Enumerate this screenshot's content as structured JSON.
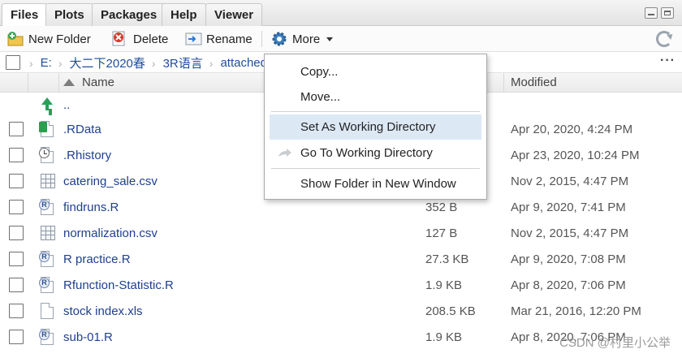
{
  "tabs": [
    {
      "label": "Files",
      "active": true
    },
    {
      "label": "Plots",
      "active": false
    },
    {
      "label": "Packages",
      "active": false
    },
    {
      "label": "Help",
      "active": false
    },
    {
      "label": "Viewer",
      "active": false
    }
  ],
  "toolbar": {
    "new_folder": "New Folder",
    "delete": "Delete",
    "rename": "Rename",
    "more": "More"
  },
  "breadcrumb": [
    "E:",
    "大二下2020春",
    "3R语言",
    "attached"
  ],
  "columns": {
    "name": "Name",
    "size": "",
    "modified": "Modified"
  },
  "parent_dir": "..",
  "files": [
    {
      "name": ".RData",
      "size": "",
      "modified": "Apr 20, 2020, 4:24 PM",
      "icon": "rdata-icon"
    },
    {
      "name": ".Rhistory",
      "size": "",
      "modified": "Apr 23, 2020, 10:24 PM",
      "icon": "history-icon"
    },
    {
      "name": "catering_sale.csv",
      "size": "",
      "modified": "Nov 2, 2015, 4:47 PM",
      "icon": "csv-icon"
    },
    {
      "name": "findruns.R",
      "size": "352 B",
      "modified": "Apr 9, 2020, 7:41 PM",
      "icon": "r-script-icon"
    },
    {
      "name": "normalization.csv",
      "size": "127 B",
      "modified": "Nov 2, 2015, 4:47 PM",
      "icon": "csv-icon"
    },
    {
      "name": "R practice.R",
      "size": "27.3 KB",
      "modified": "Apr 9, 2020, 7:08 PM",
      "icon": "r-script-icon"
    },
    {
      "name": "Rfunction-Statistic.R",
      "size": "1.9 KB",
      "modified": "Apr 8, 2020, 7:06 PM",
      "icon": "r-script-icon"
    },
    {
      "name": "stock index.xls",
      "size": "208.5 KB",
      "modified": "Mar 21, 2016, 12:20 PM",
      "icon": "file-icon"
    },
    {
      "name": "sub-01.R",
      "size": "1.9 KB",
      "modified": "Apr 8, 2020, 7:06 PM",
      "icon": "r-script-icon"
    }
  ],
  "menu": {
    "copy": "Copy...",
    "move": "Move...",
    "set_wd": "Set As Working Directory",
    "goto_wd": "Go To Working Directory",
    "show_folder": "Show Folder in New Window"
  },
  "watermark": "CSDN @村里小公举"
}
